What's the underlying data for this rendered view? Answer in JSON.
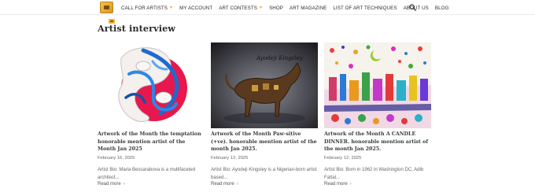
{
  "header": {
    "nav": [
      {
        "label": "Call for artists",
        "has_caret": true
      },
      {
        "label": "My account",
        "has_caret": false
      },
      {
        "label": "Art contests",
        "has_caret": true
      },
      {
        "label": "Shop",
        "has_caret": false
      },
      {
        "label": "Art magazine",
        "has_caret": false
      },
      {
        "label": "List of art techniques",
        "has_caret": false
      },
      {
        "label": "About us",
        "has_caret": false
      },
      {
        "label": "Blog",
        "has_caret": false
      }
    ],
    "caret_color": "#e8a21e",
    "search_icon": "search-icon"
  },
  "section": {
    "title": "Artist interview"
  },
  "cards": [
    {
      "title": "Artwork of the Month the temptation honorable mention artist of the Month Jan 2025",
      "date": "February 16, 2025",
      "bio": "Artist Bio: Maria Bessarabova is a multifaceted architect...",
      "more": "Read more"
    },
    {
      "title": "Artwork of the Month Paw-sitive (+ve). honorable mention artist of the month Jan 2025.",
      "date": "February 12, 2025",
      "bio": "Artist Bio: Ayodeji Kingsley is a Nigerian-born artist based...",
      "more": "Read more",
      "thumb_signature": "Ayodeji Kingsley"
    },
    {
      "title": "Artwork of the Month A CANDLE DINNER. honorable mention artist of the month Jan 2025.",
      "date": "February 12, 2025",
      "bio": "Artist Bio: Born in 1962 in Washington DC, Adib Fattal...",
      "more": "Read more"
    }
  ]
}
